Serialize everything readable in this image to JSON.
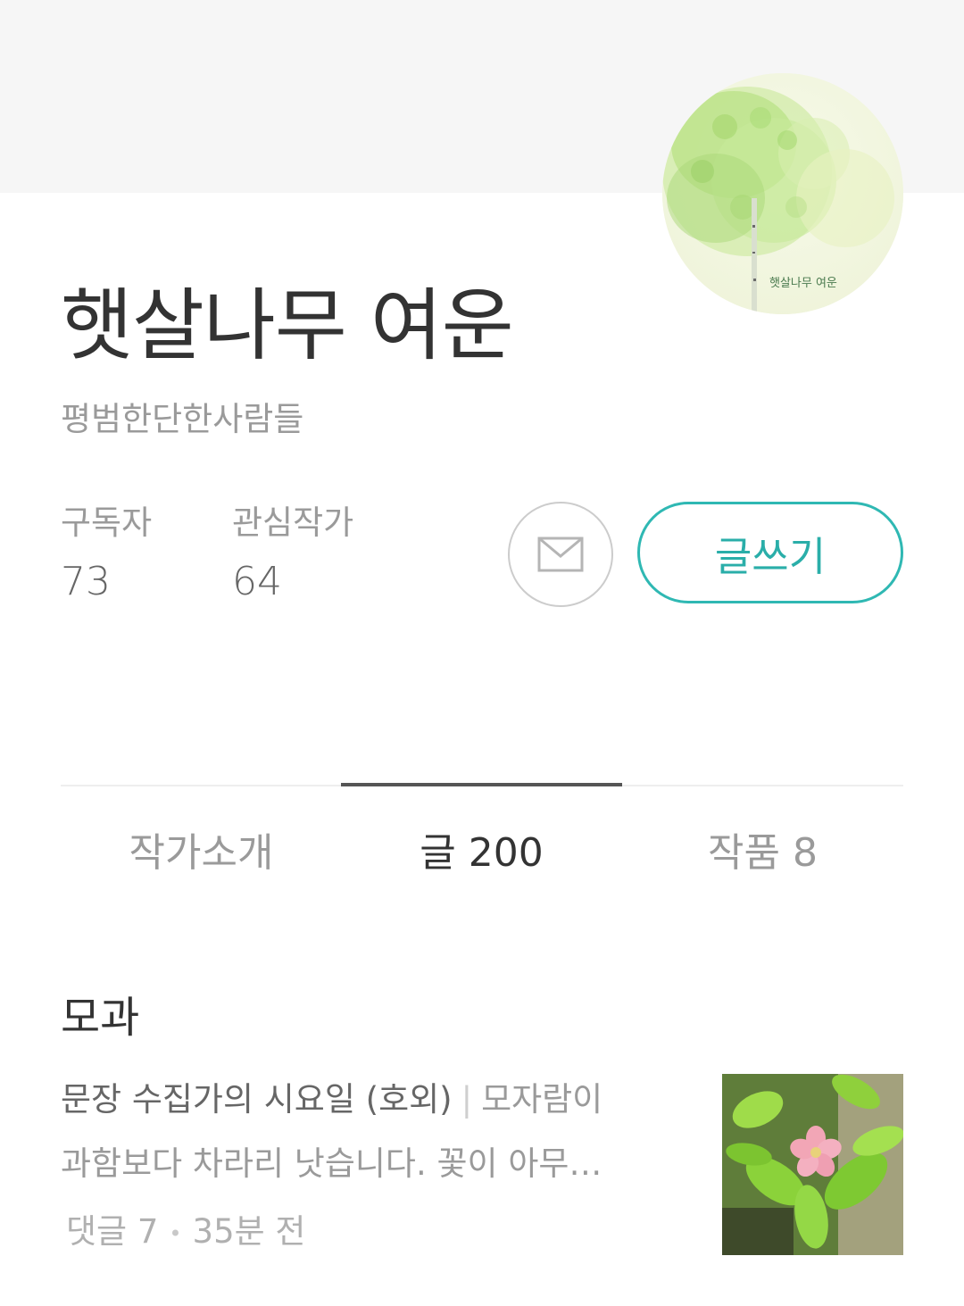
{
  "profile": {
    "name": "햇살나무 여운",
    "job": "평범한단한사람들",
    "avatar_signature": "햇살나무 여운",
    "stats": {
      "subscribers_label": "구독자",
      "subscribers_value": "73",
      "following_label": "관심작가",
      "following_value": "64"
    },
    "buttons": {
      "mail_icon": "envelope-icon",
      "write_label": "글쓰기"
    }
  },
  "tabs": [
    {
      "label": "작가소개",
      "active": false
    },
    {
      "label": "글 200",
      "active": true
    },
    {
      "label": "작품 8",
      "active": false
    }
  ],
  "post": {
    "title": "모과",
    "subtitle": "문장 수집가의 시요일 (호외)",
    "separator": "|",
    "excerpt_line1_rest": "모자람이",
    "excerpt_line2": "과함보다 차라리 낫습니다.   꽃이 아무…",
    "comments": "댓글 7",
    "time": "35분 전"
  },
  "colors": {
    "accent": "#2fb8b3",
    "header_bg": "#f6f6f6",
    "text_primary": "#333333",
    "text_muted": "#9a9a9a"
  }
}
